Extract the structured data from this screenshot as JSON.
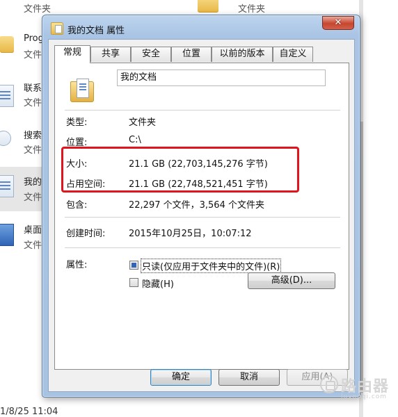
{
  "background": {
    "items": [
      {
        "label": "文件夹"
      },
      {
        "label": "文件夹"
      },
      {
        "label": "Prog"
      },
      {
        "label": "文件"
      },
      {
        "label": "联系"
      },
      {
        "label": "文件"
      },
      {
        "label": "搜索"
      },
      {
        "label": "文件"
      },
      {
        "label": "我的"
      },
      {
        "label": "文件"
      },
      {
        "label": "桌面"
      },
      {
        "label": "文件"
      }
    ],
    "status_text": "1/8/25 11:04"
  },
  "dialog": {
    "title": "我的文档 属性",
    "close_label": "✕",
    "tabs": [
      {
        "label": "常规"
      },
      {
        "label": "共享"
      },
      {
        "label": "安全"
      },
      {
        "label": "位置"
      },
      {
        "label": "以前的版本"
      },
      {
        "label": "自定义"
      }
    ],
    "name_value": "我的文档",
    "fields": {
      "type_label": "类型:",
      "type_value": "文件夹",
      "location_label": "位置:",
      "location_value": "C:\\",
      "size_label": "大小:",
      "size_value": "21.1 GB (22,703,145,276 字节)",
      "disk_size_label": "占用空间:",
      "disk_size_value": "21.1 GB (22,748,521,451 字节)",
      "contains_label": "包含:",
      "contains_value": "22,297 个文件，3,564 个文件夹",
      "created_label": "创建时间:",
      "created_value": "2015年10月25日，10:07:12",
      "attributes_label": "属性:"
    },
    "attributes": {
      "readonly_label": "只读(仅应用于文件夹中的文件)(R)",
      "hidden_label": "隐藏(H)",
      "advanced_label": "高级(D)..."
    },
    "buttons": {
      "ok": "确定",
      "cancel": "取消",
      "apply": "应用(A)"
    },
    "highlight_color": "#e1141d"
  },
  "watermark": {
    "text": "路由器",
    "sub": "luyouqi.com"
  }
}
